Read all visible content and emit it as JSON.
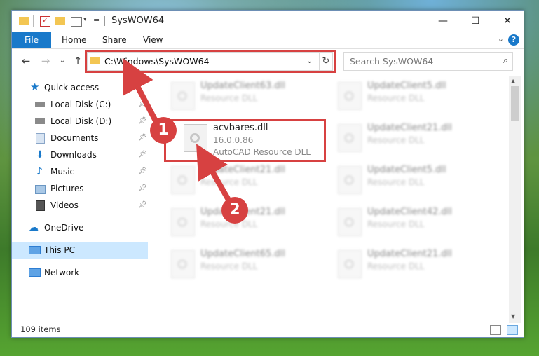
{
  "window": {
    "title": "SysWOW64",
    "controls": {
      "minimize": "—",
      "maximize": "☐",
      "close": "✕"
    }
  },
  "ribbon": {
    "tabs": [
      "File",
      "Home",
      "Share",
      "View"
    ],
    "help": "?",
    "collapse": "⌄"
  },
  "addressbar": {
    "path": "C:\\Windows\\SysWOW64",
    "dropdown": "⌄",
    "refresh": "↻"
  },
  "search": {
    "placeholder": "Search SysWOW64",
    "icon": "search-icon"
  },
  "nav_buttons": {
    "back": "←",
    "forward": "→",
    "recent": "⌄",
    "up": "↑"
  },
  "sidebar": {
    "items": [
      {
        "label": "Quick access",
        "icon": "star-icon",
        "color": "#1979ca"
      },
      {
        "label": "Local Disk (C:)",
        "icon": "disk-icon",
        "color": "#6b6b6b",
        "pinned": true
      },
      {
        "label": "Local Disk (D:)",
        "icon": "disk-icon",
        "color": "#6b6b6b",
        "pinned": true
      },
      {
        "label": "Documents",
        "icon": "documents-icon",
        "color": "#8aa6c8",
        "pinned": true
      },
      {
        "label": "Downloads",
        "icon": "download-icon",
        "color": "#1979ca",
        "pinned": true
      },
      {
        "label": "Music",
        "icon": "music-icon",
        "color": "#1979ca",
        "pinned": true
      },
      {
        "label": "Pictures",
        "icon": "pictures-icon",
        "color": "#6a96c2",
        "pinned": true
      },
      {
        "label": "Videos",
        "icon": "videos-icon",
        "color": "#444444",
        "pinned": true
      },
      {
        "label": "OneDrive",
        "icon": "cloud-icon",
        "color": "#1979ca"
      },
      {
        "label": "This PC",
        "icon": "pc-icon",
        "color": "#2d7dd2",
        "selected": true
      },
      {
        "label": "Network",
        "icon": "network-icon",
        "color": "#2d7dd2"
      }
    ]
  },
  "files": {
    "highlighted": {
      "name": "acvbares.dll",
      "version": "16.0.0.86",
      "type": "AutoCAD Resource DLL"
    },
    "blurred": [
      {
        "name": "UpdateClient63.dll",
        "type": "Resource DLL"
      },
      {
        "name": "UpdateClient5.dll",
        "type": "Resource DLL"
      },
      {
        "name": "UpdateClient21.dll",
        "type": "Resource DLL"
      },
      {
        "name": "UpdateClient21.dll",
        "type": "Resource DLL"
      },
      {
        "name": "UpdateClient5.dll",
        "type": "Resource DLL"
      },
      {
        "name": "UpdateClient21.dll",
        "type": "Resource DLL"
      },
      {
        "name": "UpdateClient42.dll",
        "type": "Resource DLL"
      },
      {
        "name": "UpdateClient65.dll",
        "type": "Resource DLL"
      },
      {
        "name": "UpdateClient21.dll",
        "type": "Resource DLL"
      }
    ]
  },
  "status": {
    "count": "109 items"
  },
  "annotations": {
    "step1": "1",
    "step2": "2",
    "color": "#d74141"
  }
}
